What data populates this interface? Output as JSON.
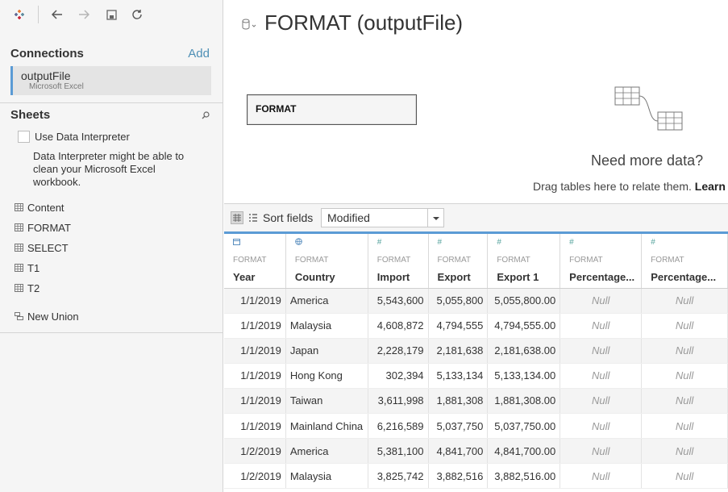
{
  "connections": {
    "title": "Connections",
    "add_label": "Add",
    "items": [
      {
        "name": "outputFile",
        "type": "Microsoft Excel"
      }
    ]
  },
  "sheets": {
    "title": "Sheets",
    "use_interpreter_label": "Use Data Interpreter",
    "interpreter_description": "Data Interpreter might be able to clean your Microsoft Excel workbook.",
    "items": [
      "Content",
      "FORMAT",
      "SELECT",
      "T1",
      "T2"
    ],
    "new_union_label": "New Union"
  },
  "page": {
    "title": "FORMAT (outputFile)"
  },
  "canvas": {
    "table_name": "FORMAT",
    "need_more_title": "Need more data?",
    "drag_hint": "Drag tables here to relate them.",
    "drag_hint_link": "Learn"
  },
  "sortbar": {
    "label": "Sort fields",
    "selected": "Modified"
  },
  "grid": {
    "columns": [
      {
        "source": "FORMAT",
        "name": "Year",
        "type_icon": "calendar-icon"
      },
      {
        "source": "FORMAT",
        "name": "Country",
        "type_icon": "globe-icon"
      },
      {
        "source": "FORMAT",
        "name": "Import",
        "type_icon": "number-icon"
      },
      {
        "source": "FORMAT",
        "name": "Export",
        "type_icon": "number-icon"
      },
      {
        "source": "FORMAT",
        "name": "Export 1",
        "type_icon": "number-icon"
      },
      {
        "source": "FORMAT",
        "name": "Percentage...",
        "type_icon": "number-icon"
      },
      {
        "source": "FORMAT",
        "name": "Percentage...",
        "type_icon": "number-icon"
      }
    ],
    "rows": [
      [
        "1/1/2019",
        "America",
        "5,543,600",
        "5,055,800",
        "5,055,800.00",
        "Null",
        "Null"
      ],
      [
        "1/1/2019",
        "Malaysia",
        "4,608,872",
        "4,794,555",
        "4,794,555.00",
        "Null",
        "Null"
      ],
      [
        "1/1/2019",
        "Japan",
        "2,228,179",
        "2,181,638",
        "2,181,638.00",
        "Null",
        "Null"
      ],
      [
        "1/1/2019",
        "Hong Kong",
        "302,394",
        "5,133,134",
        "5,133,134.00",
        "Null",
        "Null"
      ],
      [
        "1/1/2019",
        "Taiwan",
        "3,611,998",
        "1,881,308",
        "1,881,308.00",
        "Null",
        "Null"
      ],
      [
        "1/1/2019",
        "Mainland China",
        "6,216,589",
        "5,037,750",
        "5,037,750.00",
        "Null",
        "Null"
      ],
      [
        "1/2/2019",
        "America",
        "5,381,100",
        "4,841,700",
        "4,841,700.00",
        "Null",
        "Null"
      ],
      [
        "1/2/2019",
        "Malaysia",
        "3,825,742",
        "3,882,516",
        "3,882,516.00",
        "Null",
        "Null"
      ]
    ]
  },
  "colors": {
    "accent": "#5b9bd5",
    "link": "#4e8fb5",
    "type_icon": "#5ba6a0"
  }
}
